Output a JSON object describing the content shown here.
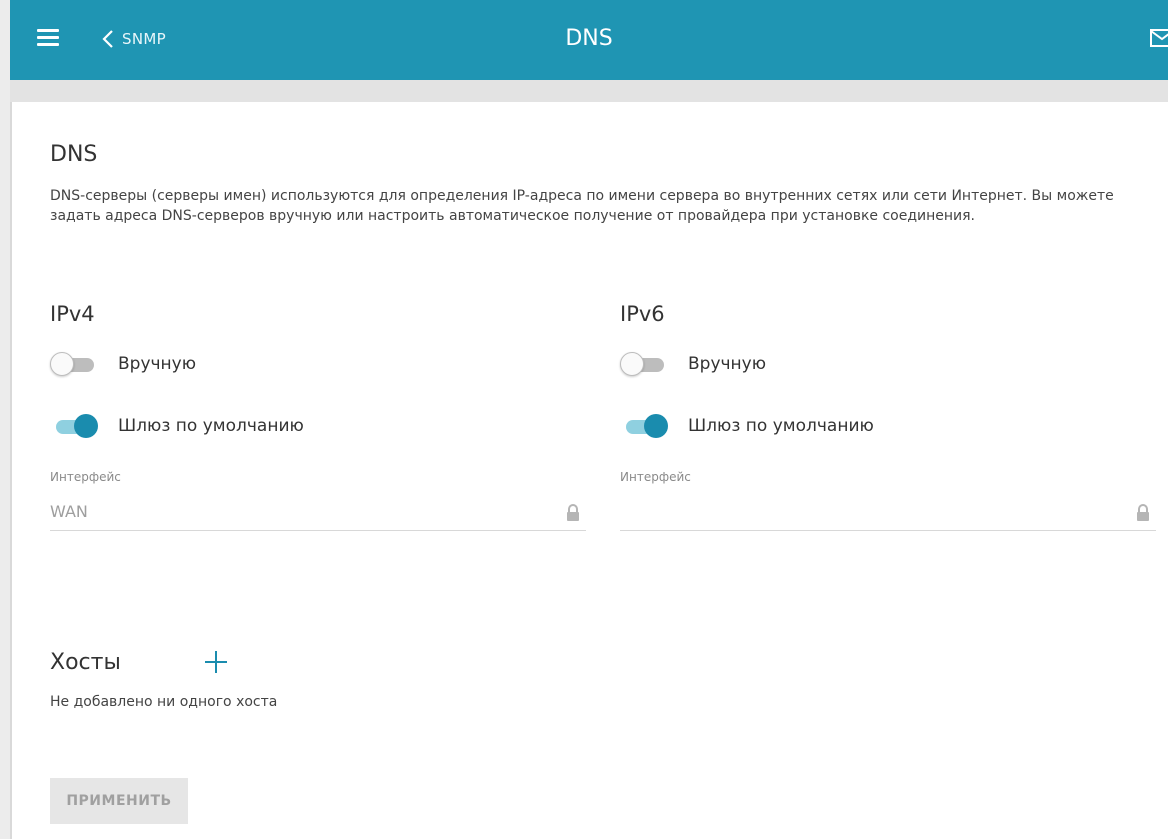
{
  "header": {
    "back_label": "SNMP",
    "title": "DNS"
  },
  "section": {
    "title": "DNS",
    "description": "DNS-серверы (серверы имен) используются для определения IP-адреса по имени сервера во внутренних сетях или сети Интернет. Вы можете задать адреса DNS-серверов вручную или настроить автоматическое получение от провайдера при установке соединения."
  },
  "ipv4": {
    "title": "IPv4",
    "manual_label": "Вручную",
    "manual_on": false,
    "gateway_label": "Шлюз по умолчанию",
    "gateway_on": true,
    "interface_label": "Интерфейс",
    "interface_value": "WAN"
  },
  "ipv6": {
    "title": "IPv6",
    "manual_label": "Вручную",
    "manual_on": false,
    "gateway_label": "Шлюз по умолчанию",
    "gateway_on": true,
    "interface_label": "Интерфейс",
    "interface_value": ""
  },
  "hosts": {
    "title": "Хосты",
    "empty_text": "Не добавлено ни одного хоста"
  },
  "apply_label": "ПРИМЕНИТЬ",
  "colors": {
    "header_bg": "#1f95b3",
    "accent": "#1a8cae",
    "toggle_track_on": "#8fd0e0"
  },
  "icons": {
    "menu": "hamburger-icon",
    "back": "chevron-left-icon",
    "mail": "mail-icon",
    "lock": "lock-icon",
    "add": "plus-icon"
  }
}
